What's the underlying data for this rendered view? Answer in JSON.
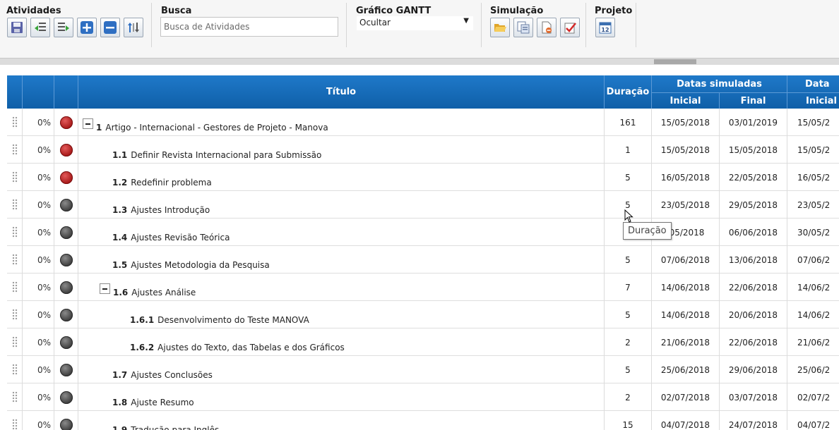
{
  "toolbar": {
    "atividades": {
      "title": "Atividades",
      "buttons": [
        {
          "icon": "save-icon",
          "label": "Salvar"
        },
        {
          "icon": "outdent-icon",
          "label": "Recuar"
        },
        {
          "icon": "indent-icon",
          "label": "Avançar"
        },
        {
          "icon": "plus-icon",
          "label": "Adicionar"
        },
        {
          "icon": "minus-icon",
          "label": "Remover"
        },
        {
          "icon": "sort-icon",
          "label": "Ordenar"
        }
      ]
    },
    "busca": {
      "title": "Busca",
      "placeholder": "Busca de Atividades",
      "value": ""
    },
    "gantt": {
      "title": "Gráfico GANTT",
      "selected": "Ocultar"
    },
    "simulacao": {
      "title": "Simulação",
      "icons": [
        "folder-open-icon",
        "copy-icon",
        "document-remove-icon",
        "checklist-icon"
      ]
    },
    "projeto": {
      "title": "Projeto",
      "icon": "calendar-icon",
      "calendar_day": "12"
    }
  },
  "grid": {
    "headers": {
      "titulo": "Título",
      "duracao": "Duração",
      "datas_simuladas": "Datas simuladas",
      "inicial": "Inicial",
      "final": "Final",
      "datas_cut": "Data",
      "inicial_cut": "Inicial"
    },
    "rows": [
      {
        "pct": "0%",
        "status": "red",
        "num": "1",
        "title": "Artigo - Internacional - Gestores de Projeto - Manova",
        "dur": "161",
        "ini": "15/05/2018",
        "fin": "03/01/2019",
        "ini2": "15/05/2",
        "level": 0,
        "toggle": true
      },
      {
        "pct": "0%",
        "status": "red",
        "num": "1.1",
        "title": "Definir Revista Internacional para Submissão",
        "dur": "1",
        "ini": "15/05/2018",
        "fin": "15/05/2018",
        "ini2": "15/05/2",
        "level": 1,
        "toggle": false
      },
      {
        "pct": "0%",
        "status": "red",
        "num": "1.2",
        "title": "Redefinir problema",
        "dur": "5",
        "ini": "16/05/2018",
        "fin": "22/05/2018",
        "ini2": "16/05/2",
        "level": 1,
        "toggle": false
      },
      {
        "pct": "0%",
        "status": "gray",
        "num": "1.3",
        "title": "Ajustes Introdução",
        "dur": "5",
        "ini": "23/05/2018",
        "fin": "29/05/2018",
        "ini2": "23/05/2",
        "level": 1,
        "toggle": false
      },
      {
        "pct": "0%",
        "status": "gray",
        "num": "1.4",
        "title": "Ajustes Revisão Teórica",
        "dur": "",
        "ini": "/05/2018",
        "fin": "06/06/2018",
        "ini2": "30/05/2",
        "level": 1,
        "toggle": false
      },
      {
        "pct": "0%",
        "status": "gray",
        "num": "1.5",
        "title": "Ajustes Metodologia da Pesquisa",
        "dur": "5",
        "ini": "07/06/2018",
        "fin": "13/06/2018",
        "ini2": "07/06/2",
        "level": 1,
        "toggle": false
      },
      {
        "pct": "0%",
        "status": "gray",
        "num": "1.6",
        "title": "Ajustes Análise",
        "dur": "7",
        "ini": "14/06/2018",
        "fin": "22/06/2018",
        "ini2": "14/06/2",
        "level": 1,
        "toggle": true
      },
      {
        "pct": "0%",
        "status": "gray",
        "num": "1.6.1",
        "title": "Desenvolvimento do Teste MANOVA",
        "dur": "5",
        "ini": "14/06/2018",
        "fin": "20/06/2018",
        "ini2": "14/06/2",
        "level": 2,
        "toggle": false
      },
      {
        "pct": "0%",
        "status": "gray",
        "num": "1.6.2",
        "title": "Ajustes do Texto, das Tabelas e dos Gráficos",
        "dur": "2",
        "ini": "21/06/2018",
        "fin": "22/06/2018",
        "ini2": "21/06/2",
        "level": 2,
        "toggle": false
      },
      {
        "pct": "0%",
        "status": "gray",
        "num": "1.7",
        "title": "Ajustes Conclusões",
        "dur": "5",
        "ini": "25/06/2018",
        "fin": "29/06/2018",
        "ini2": "25/06/2",
        "level": 1,
        "toggle": false
      },
      {
        "pct": "0%",
        "status": "gray",
        "num": "1.8",
        "title": "Ajuste Resumo",
        "dur": "2",
        "ini": "02/07/2018",
        "fin": "03/07/2018",
        "ini2": "02/07/2",
        "level": 1,
        "toggle": false
      },
      {
        "pct": "0%",
        "status": "gray",
        "num": "1.9",
        "title": "Tradução para Inglês",
        "dur": "15",
        "ini": "04/07/2018",
        "fin": "24/07/2018",
        "ini2": "04/07/2",
        "level": 1,
        "toggle": false
      }
    ]
  },
  "tooltip": {
    "text": "Duração"
  },
  "colors": {
    "header_blue": "#1f79c9",
    "status_red": "#a51717",
    "status_gray": "#3c3c3c"
  }
}
